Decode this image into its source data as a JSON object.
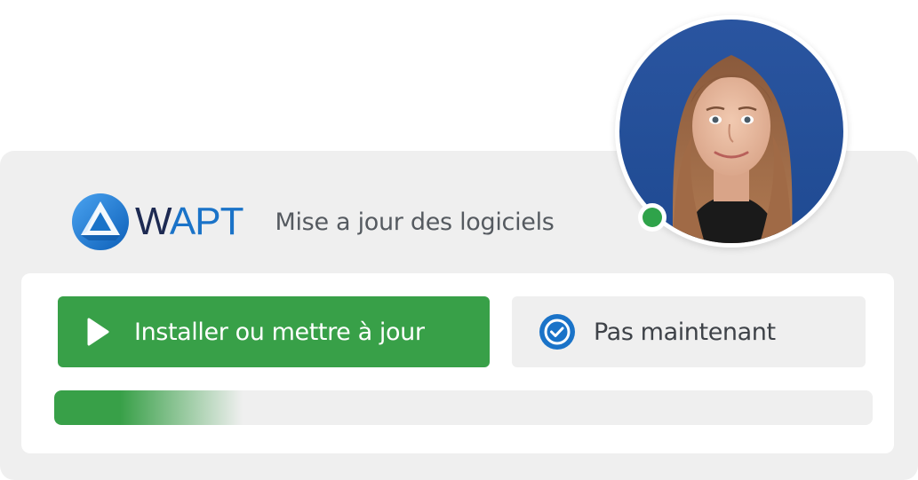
{
  "header": {
    "logo_text_w": "W",
    "logo_text_apt": "APT",
    "subtitle": "Mise a jour des logiciels"
  },
  "actions": {
    "install_label": "Installer ou mettre à jour",
    "later_label": "Pas maintenant",
    "install_icon": "play-icon",
    "later_icon": "check-circle-icon"
  },
  "progress": {
    "fraction": 0.23
  },
  "user": {
    "status": "online"
  },
  "colors": {
    "primary_green": "#38a048",
    "status_green": "#2fa34a",
    "brand_blue": "#1a73c8",
    "brand_navy": "#1d2a52",
    "panel_gray": "#efefef"
  }
}
